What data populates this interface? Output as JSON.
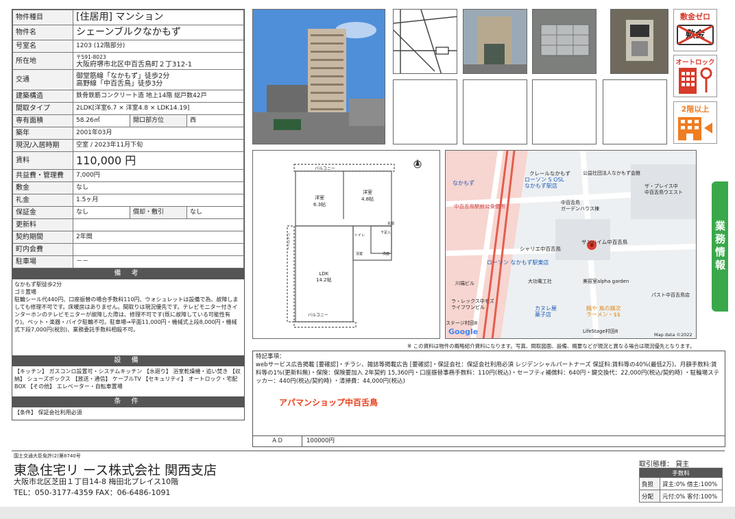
{
  "spec": {
    "rows": {
      "type_label": "物件種目",
      "type_value": "[住居用] マンション",
      "name_label": "物件名",
      "name_value": "シェーンブルクなかもず",
      "room_label": "号室名",
      "room_value": "1203 (12階部分)",
      "addr_label": "所在地",
      "zip": "〒591-8023",
      "addr": "大阪府堺市北区中百舌鳥町２丁312-1",
      "access_label": "交通",
      "access1": "御堂筋線「なかもず」徒歩2分",
      "access2": "高野線「中百舌鳥」徒歩3分",
      "struct_label": "建築構造",
      "struct_value": "鉄骨鉄筋コンクリート造 地上14階 総戸数42戸",
      "layout_label": "間取タイプ",
      "layout_value": "2LDK[洋室6.7 × 洋室4.8 × LDK14.19]",
      "area_label": "専有面積",
      "area_value": "58.26㎡",
      "dir_label": "開口部方位",
      "dir_value": "西",
      "built_label": "築年",
      "built_value": "2001年03月",
      "status_label": "現況/入居時期",
      "status_value": "空室 / 2023年11月下旬",
      "rent_label": "賃料",
      "rent_value": "110,000 円",
      "mgmt_label": "共益費・管理費",
      "mgmt_value": "7,000円",
      "deposit_label": "敷金",
      "deposit_value": "なし",
      "key_label": "礼金",
      "key_value": "1.5ヶ月",
      "hosho_label": "保証金",
      "hosho_value": "なし",
      "shokyaku_label": "償却・敷引",
      "shokyaku_value": "なし",
      "renew_label": "更新料",
      "renew_value": "",
      "term_label": "契約期間",
      "term_value": "2年間",
      "assoc_label": "町内会費",
      "assoc_value": "",
      "parking_label": "駐車場",
      "parking_value": "－－"
    },
    "bikou_title": "備 考",
    "bikou_text": "なかもず駅徒歩2分\nゴミ置場\n駐輪シール代440円、口座振替の場合手数料110円、ウォシュレットは設備で為、故障しましても修理不可です。床暖房はありません。間取りは現況優先です。テレビモニター付きインターホンのテレビモニターが故障した際は、修理不可です(既に故障している可能性有り)。ペット・楽器・バイク駐輪不可。駐車場→平面11,000円・機械式上段8,000円・機械式下段7,000円(税別)、業務委託手数料相殺不可。",
    "setsubi_title": "設 備",
    "setsubi_text": "【キッチン】 ガスコンロ設置可・システムキッチン 【水廻り】 浴室乾燥機・追い焚き 【収納】 シューズボックス 【放送・通信】 ケーブルTV 【セキュリティ】 オートロック・宅配BOX 【その他】 エレベーター・自転車置場",
    "joken_title": "条 件",
    "joken_text": "【条件】 保証会社利用必須"
  },
  "icons": {
    "deposit_zero": "敷金ゼロ",
    "deposit_crossed": "敷金",
    "autolock": "オートロック",
    "floor2": "2階以上"
  },
  "floorplan": {
    "balcony_top": "バルコニー",
    "balcony_bottom": "バルコニー",
    "room1": "洋室\n6.3帖",
    "room2": "洋室\n4.8帖",
    "ldk": "LDK\n14.2帖",
    "entrance": "玄関",
    "bath": "浴室",
    "wash": "洗面",
    "toilet": "トイレ",
    "shoebox": "下足入",
    "balcony_side": "バルコニー"
  },
  "map": {
    "labels": [
      "クレールなかもず",
      "公益社団法人なかもず会館",
      "なかもず",
      "ローソン S OSL\nなかもず駅店",
      "ザ・プレイス中\n中百舌鳥ウエスト",
      "中百舌鳥駅前公衆便所",
      "中百舌鳥\nガーデンハウス棟",
      "シャリエ中百舌鳥",
      "サンハイム中百舌鳥",
      "ローソン なかもず駅東店",
      "大功電工社",
      "美容室alpha garden",
      "川端ビル",
      "パスト中百舌鳥店",
      "ラ・レックス中モズ\nライフワンビル",
      "カヌレ屋\n菓子店",
      "麺や 鳥の鶏次\nラーメン・$$",
      "ステージ村田8",
      "LifeStage村田8",
      "Map data ©2022"
    ],
    "brand": "Google"
  },
  "disclaimer": "※ この資料は物件の概略紹介資料になります。写真、間取図面、設備、概要などが現況と異なる場合は現況優先となります。",
  "remarks": {
    "title": "特記事項：",
    "text": "webサービス広告掲載 [要確認]・チラシ、雑誌等掲載広告 [要確認]・保証会社：保証会社利用必須 レジデンシャルパートナーズ 保証料:賃料等の40%(最低2万)、月額手数料:賃料等の1%(更新料無)・保険：保険要加入 2年契約 15,360円・口座振替事務手数料：110円(税込)・セーフティ補償料：640円・鍵交換代：22,000円(税込/契約時) ・駐輪場ステッカー：440円(税込/契約時) ・清掃費：44,000円(税込)",
    "shop": "アパマンショップ中百舌鳥",
    "ad_label": "ＡＤ",
    "ad_value": "100000円"
  },
  "footer": {
    "license": "国土交通大臣免許(2)第8740号",
    "company": "東急住宅リ ース株式会社 関西支店",
    "address": "大阪市北区芝田１丁目14-8 梅田北プレイス10階",
    "tel": "TEL：050-3177-4359 FAX：06-6486-1091",
    "deal_label": "取引態様：",
    "deal_value": "貸主",
    "fee_title": "手数料",
    "fee_rows": [
      {
        "k": "負担",
        "v": "貸主:0% 借主:100%"
      },
      {
        "k": "分配",
        "v": "元付:0% 客付:100%"
      }
    ]
  },
  "side_tab": "業務情報",
  "colors": {
    "green_tab": "#3aa84a",
    "shop_red": "#e8401c",
    "icon_red": "#d83a2b",
    "icon_orange": "#ef7d22"
  }
}
